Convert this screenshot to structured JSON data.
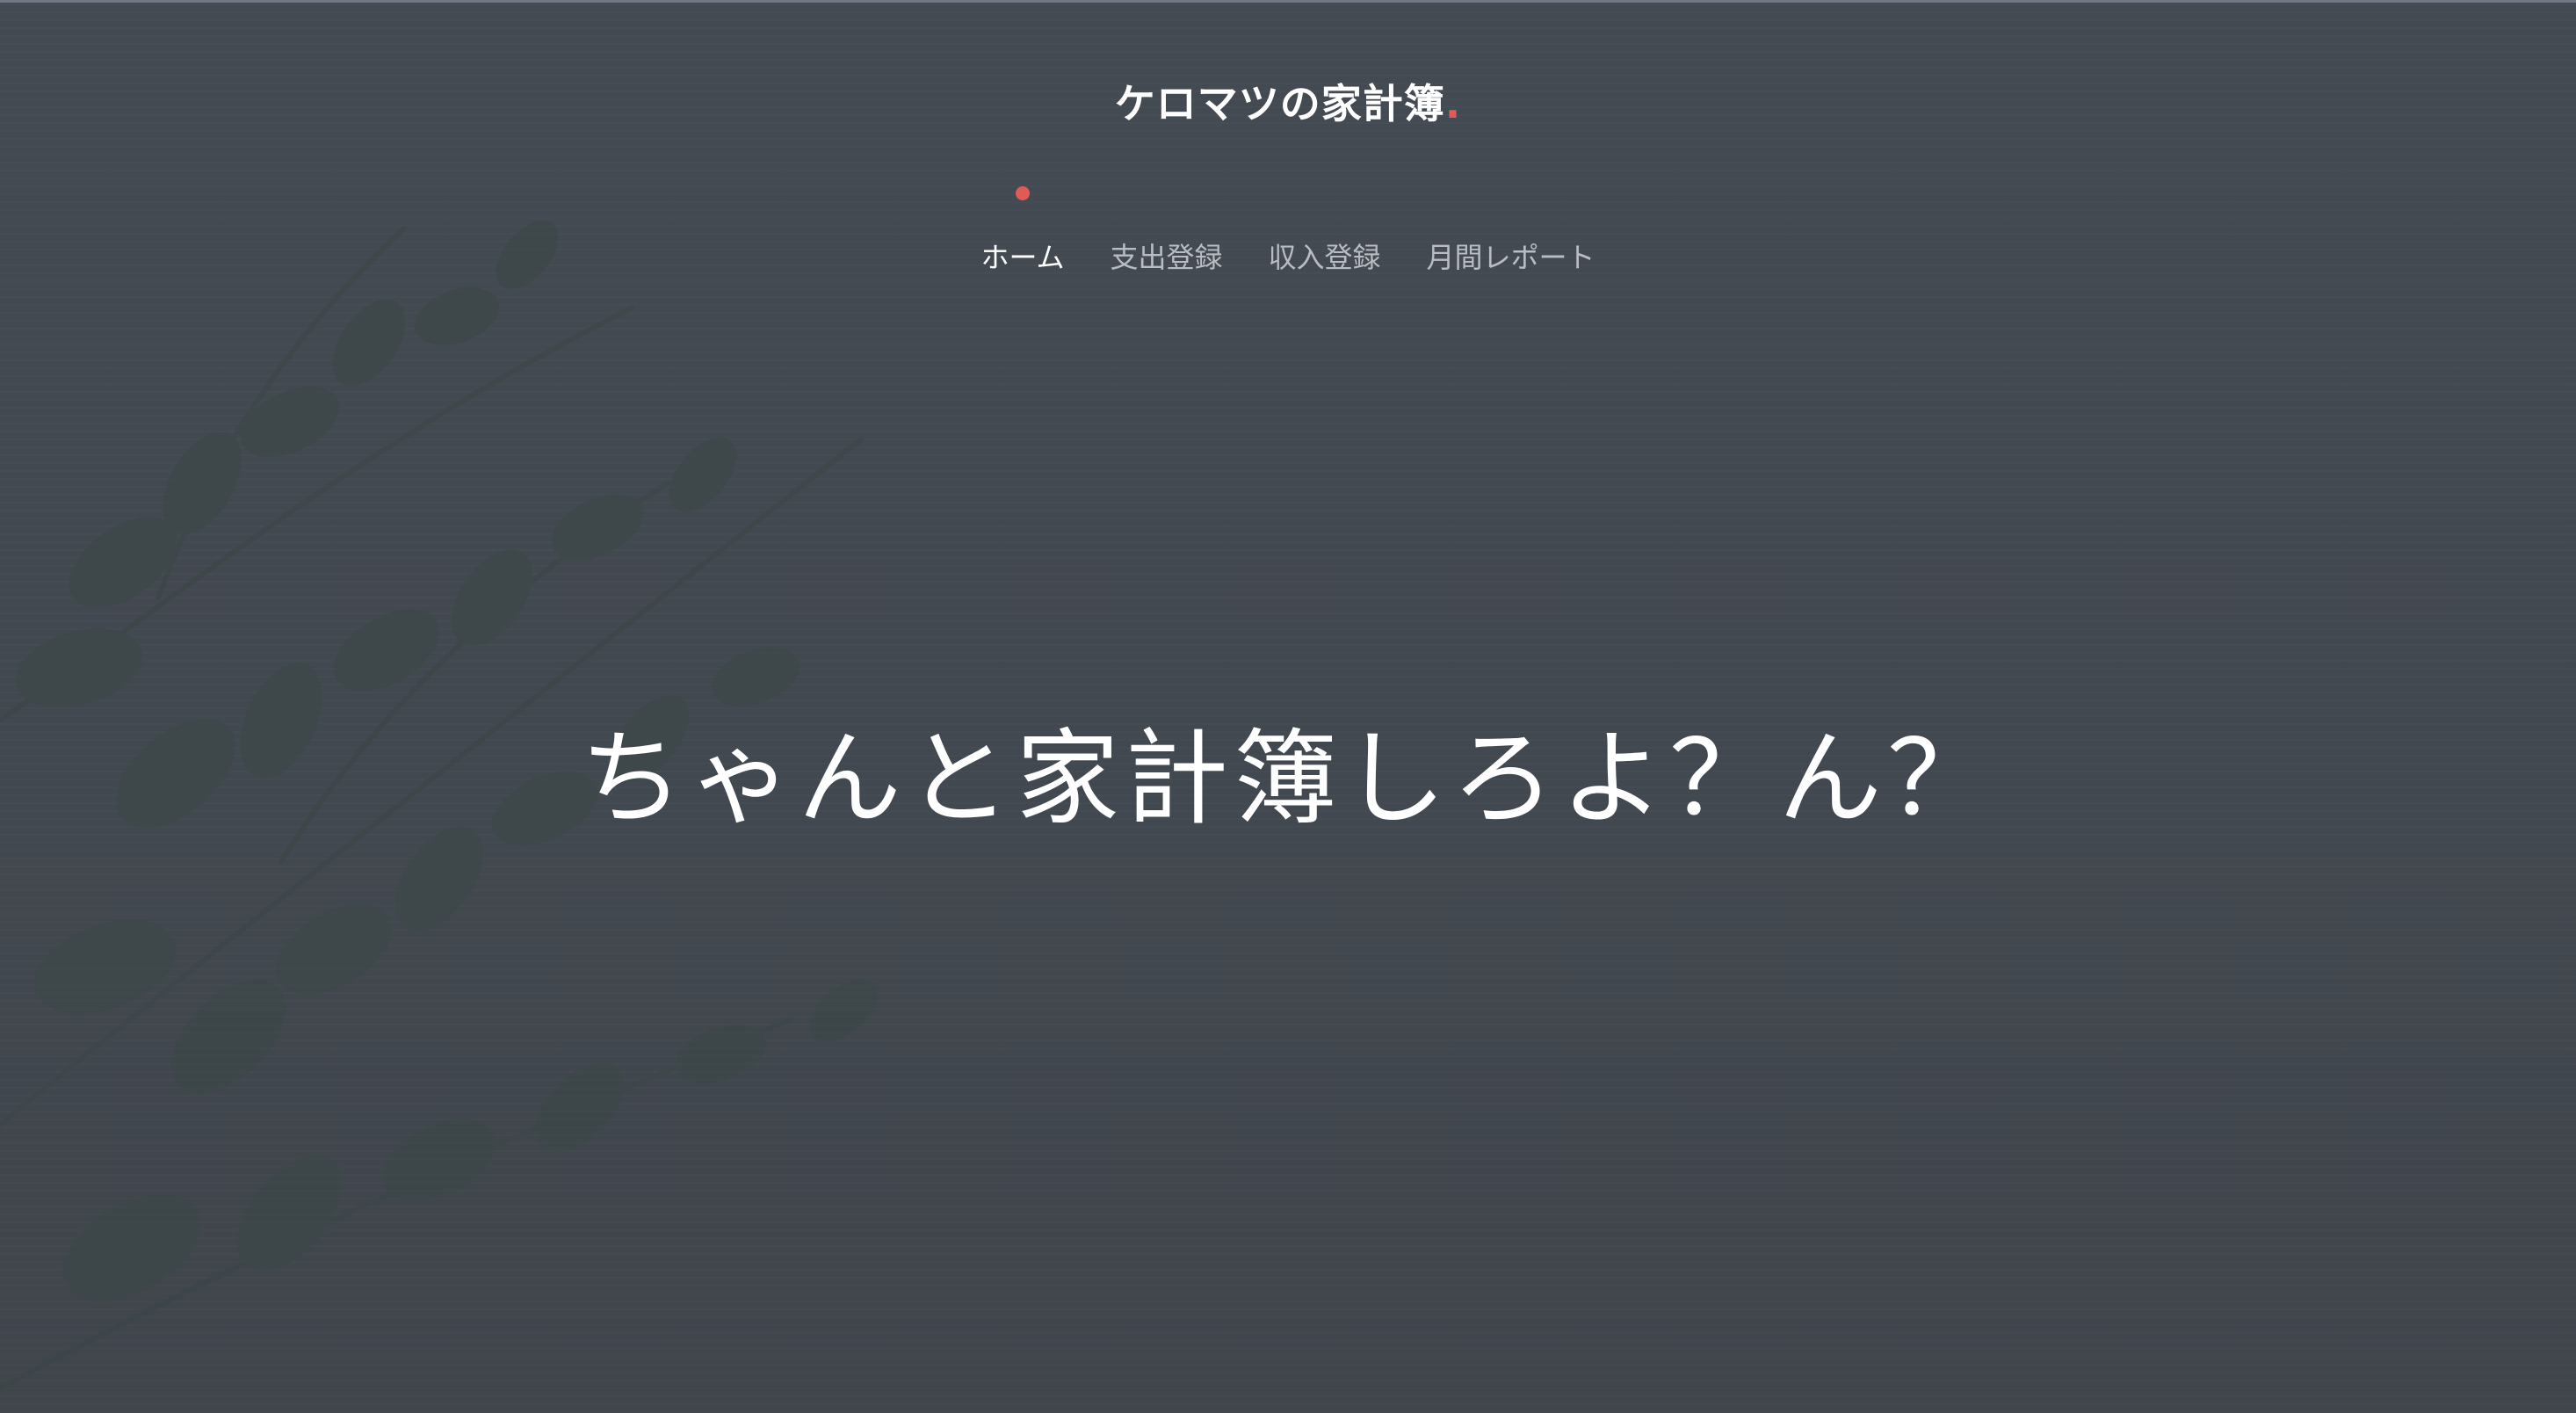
{
  "header": {
    "site_title": "ケロマツの家計簿",
    "title_dot": "."
  },
  "nav": {
    "items": [
      {
        "label": "ホーム",
        "active": true
      },
      {
        "label": "支出登録",
        "active": false
      },
      {
        "label": "収入登録",
        "active": false
      },
      {
        "label": "月間レポート",
        "active": false
      }
    ]
  },
  "hero": {
    "text": "ちゃんと家計簿しろよ？ん？"
  },
  "colors": {
    "background": "#434950",
    "accent": "#e05a57",
    "nav_inactive": "#b9bdc3",
    "text": "#ffffff"
  }
}
